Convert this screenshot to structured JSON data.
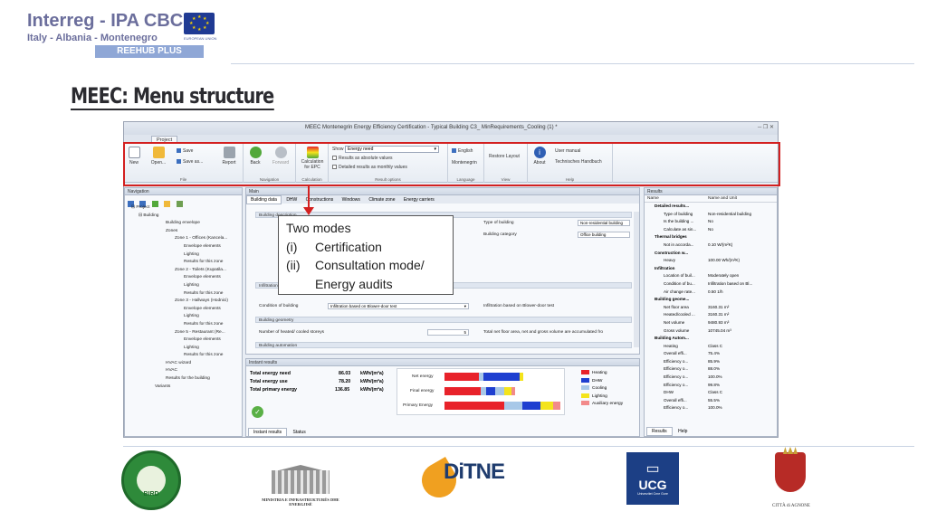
{
  "header": {
    "logo_title": "Interreg - IPA CBC",
    "logo_subtitle": "Italy - Albania - Montenegro",
    "project": "REEHUB PLUS",
    "eu_label": "EUROPEAN UNION",
    "slide_title": "MEEC: Menu structure"
  },
  "app": {
    "window_title": "MEEC Montenegrin Energy Efficiency Certification - Typical Building C3_ MinRequirements_Cooling (1) *",
    "tabs": [
      "Project"
    ],
    "ribbon": {
      "file": {
        "label": "File",
        "new": "New",
        "open": "Open...",
        "save": "Save",
        "save_as": "Save as...",
        "report": "Report"
      },
      "navigation": {
        "label": "Navigation",
        "back": "Back",
        "forward": "Forward"
      },
      "calculation": {
        "label": "Calculation",
        "calc": "Calculation for EPC"
      },
      "result_options": {
        "label": "Result options",
        "show": "Show",
        "show_value": "Energy need",
        "abs": "Results as absolute values",
        "monthly": "Detailed results as monthly values"
      },
      "language": {
        "label": "Language",
        "english": "English",
        "montenegrin": "Montenegrin"
      },
      "view": {
        "label": "View",
        "restore": "Restore Layout"
      },
      "help": {
        "label": "Help",
        "about": "About",
        "manual": "User manual",
        "handbook": "Technisches Handbuch"
      }
    },
    "navigation": {
      "title": "Navigation",
      "items": [
        "Project",
        "Building",
        "Building envelope",
        "Zones",
        "Zone 1 - Offices (Kancela...",
        "Envelope elements",
        "Lighting",
        "Results for this zone",
        "Zone 2 - Toilets (Kupatila...",
        "Envelope elements",
        "Lighting",
        "Results for this zone",
        "Zone 3 - Hallways (Hodnici)",
        "Envelope elements",
        "Lighting",
        "Results for this zone",
        "Zone 5 - Restaurant (Re...",
        "Envelope elements",
        "Lighting",
        "Results for this zone",
        "HVAC wizard",
        "HVAC",
        "Results for the building",
        "Variants"
      ]
    },
    "main": {
      "title": "Main",
      "tabs": [
        "Building data",
        "DHW",
        "Constructions",
        "Windows",
        "Climate zone",
        "Energy carriers"
      ],
      "sections": {
        "desc": "Building description",
        "type_label": "Type of building",
        "type_value": "Non-residential building",
        "cat_label": "Building category",
        "cat_value": "Office building",
        "infil": "Infiltration",
        "cond_label": "Condition of building",
        "cond_value": "Infiltration based on Blower-door test",
        "infil_right": "Infiltration based on Blower-door test",
        "geom": "Building geometry",
        "storeys_label": "Number of heated/ cooled storeys",
        "storeys_value": "5",
        "area_note": "Total net floor area, net and gross volume  are accumulated fro",
        "auto": "Building automation"
      }
    },
    "instant": {
      "title": "Instant results",
      "rows": [
        {
          "label": "Total energy need",
          "value": "86.03",
          "unit": "kWh/(m²a)"
        },
        {
          "label": "Total energy use",
          "value": "78.20",
          "unit": "kWh/(m²a)"
        },
        {
          "label": "Total primary energy",
          "value": "136.85",
          "unit": "kWh/(m²a)"
        }
      ],
      "chart_labels": [
        "Net energy",
        "Final energy",
        "Primary Energy"
      ],
      "legend": [
        {
          "name": "Heating",
          "color": "#e8222a"
        },
        {
          "name": "DHW",
          "color": "#1e3fd0"
        },
        {
          "name": "Cooling",
          "color": "#a8c8e8"
        },
        {
          "name": "Lighting",
          "color": "#f4e41c"
        },
        {
          "name": "Auxiliary energy",
          "color": "#f28a8a"
        }
      ],
      "tabs": [
        "Instant results",
        "Status"
      ]
    },
    "results": {
      "title": "Results",
      "col_name": "Name",
      "col_unit": "Name and Unit",
      "rows": [
        {
          "n": "Detailed results...",
          "v": ""
        },
        {
          "n": "Type of building",
          "v": "Non-residential building"
        },
        {
          "n": "Is the building ...",
          "v": "No"
        },
        {
          "n": "Calculate as sin...",
          "v": "No"
        },
        {
          "n": "Thermal bridges",
          "v": ""
        },
        {
          "n": "Not in accorda...",
          "v": "0.10 W/(m²K)"
        },
        {
          "n": "Construction w...",
          "v": ""
        },
        {
          "n": "Heavy",
          "v": "100.00 Wh/(m²K)"
        },
        {
          "n": "Infiltration",
          "v": ""
        },
        {
          "n": "Location of buil...",
          "v": "Moderately open"
        },
        {
          "n": "Condition of bu...",
          "v": "Infiltration based on Bl..."
        },
        {
          "n": "Air change rate...",
          "v": "0.50 1/h"
        },
        {
          "n": "Building geome...",
          "v": ""
        },
        {
          "n": "Net floor area",
          "v": "3160.31 m²"
        },
        {
          "n": "Heated/cooled ...",
          "v": "3160.31 m²"
        },
        {
          "n": "Net volume",
          "v": "9480.93 m³"
        },
        {
          "n": "Gross volume",
          "v": "10745.04 m³"
        },
        {
          "n": "Building Autom...",
          "v": ""
        },
        {
          "n": "Heating",
          "v": "Class C"
        },
        {
          "n": "Overall effi...",
          "v": "75.4%"
        },
        {
          "n": "Efficiency o...",
          "v": "85.9%"
        },
        {
          "n": "Efficiency o...",
          "v": "88.0%"
        },
        {
          "n": "Efficiency o...",
          "v": "100.0%"
        },
        {
          "n": "Efficiency o...",
          "v": "99.8%"
        },
        {
          "n": "DHW",
          "v": "Class C"
        },
        {
          "n": "Overall effi...",
          "v": "55.5%"
        },
        {
          "n": "Efficiency o...",
          "v": "100.0%"
        }
      ],
      "tabs": [
        "Results",
        "Help"
      ]
    }
  },
  "callout": {
    "line1": "Two modes",
    "line2_num": "(i)",
    "line2": "Certification",
    "line3_num": "(ii)",
    "line3": "Consultation mode/",
    "line4": "Energy audits"
  },
  "footer": {
    "bird": "BIRD",
    "ministry": "MINISTRIA E INFRASTRUKTURËS DHE ENERGJISË",
    "ditne": "DiTNE",
    "ucg": "UCG",
    "ucg_sub": "Univerzitet Crne Gore",
    "citta": "CITTÀ di AGNONE"
  }
}
